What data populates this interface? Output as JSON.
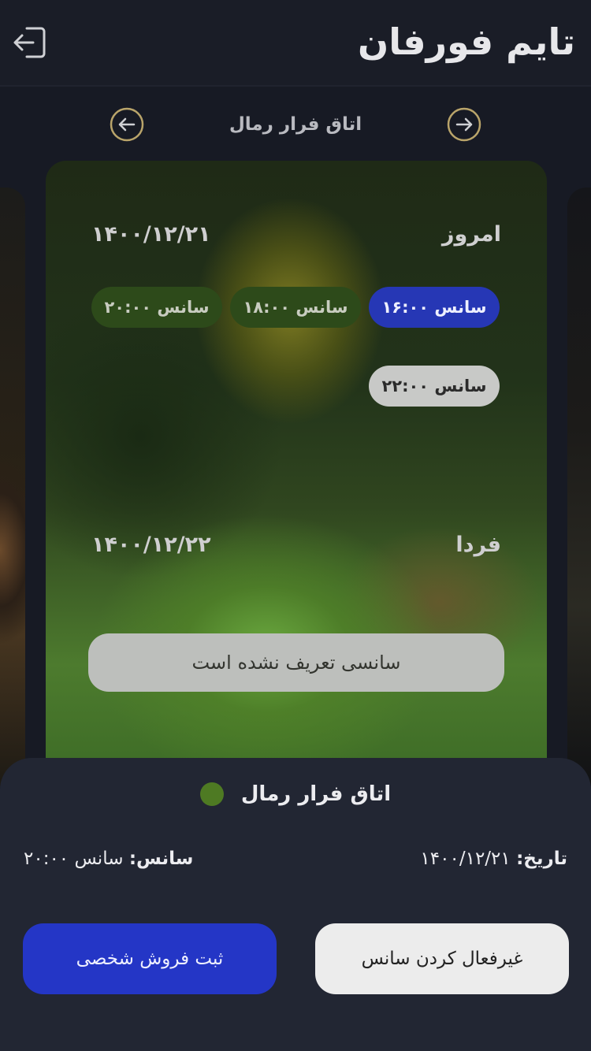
{
  "header": {
    "logo_text": "تایم فورفان"
  },
  "room": {
    "title": "اتاق فرار رمال"
  },
  "schedule": {
    "today": {
      "day_label": "امروز",
      "date": "۱۴۰۰/۱۲/۲۱",
      "sessions": [
        {
          "label": "سانس ۱۶:۰۰",
          "state": "selected"
        },
        {
          "label": "سانس ۱۸:۰۰",
          "state": "available"
        },
        {
          "label": "سانس ۲۰:۰۰",
          "state": "available"
        },
        {
          "label": "سانس ۲۲:۰۰",
          "state": "disabled"
        }
      ]
    },
    "tomorrow": {
      "day_label": "فردا",
      "date": "۱۴۰۰/۱۲/۲۲",
      "empty_text": "سانسی تعریف نشده است"
    }
  },
  "sheet": {
    "title": "اتاق فرار رمال",
    "date_label": "تاریخ:",
    "date_value": "۱۴۰۰/۱۲/۲۱",
    "session_label": "سانس:",
    "session_value": "سانس ۲۰:۰۰",
    "primary_button": "ثبت فروش شخصی",
    "secondary_button": "غیرفعال کردن سانس",
    "status_color": "#4e7a23"
  },
  "colors": {
    "accent_blue": "#2637b5",
    "nav_ring": "#b9a46a"
  }
}
